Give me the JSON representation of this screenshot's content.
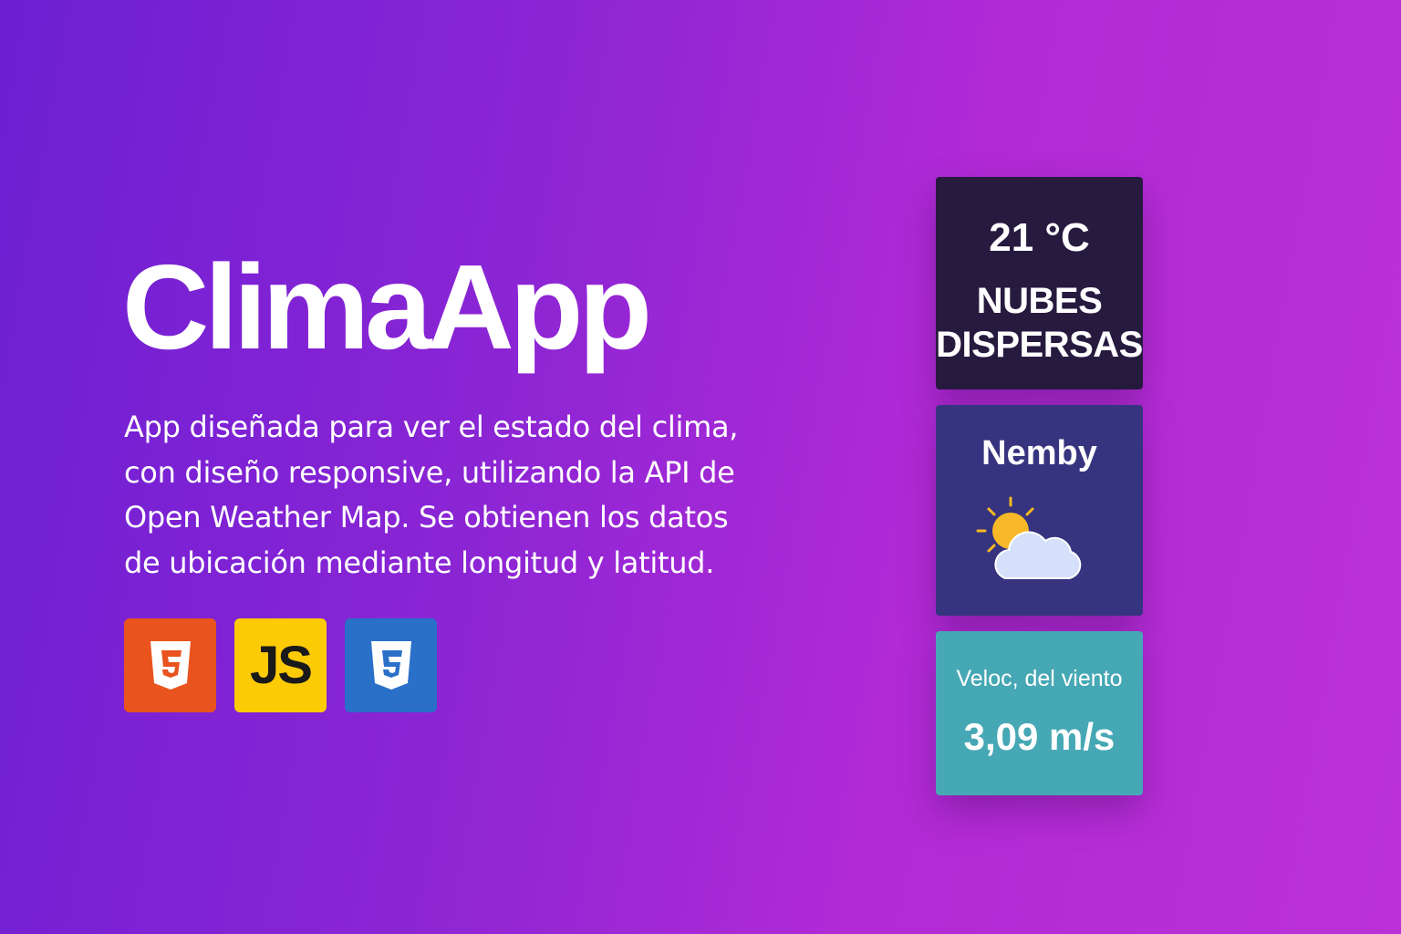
{
  "hero": {
    "title": "ClimaApp",
    "description_lines": [
      "App diseñada para ver el estado del clima,",
      "con diseño responsive, utilizando la API de",
      "Open Weather Map. Se obtienen los datos",
      "de ubicación mediante longitud y latitud."
    ],
    "tech": [
      {
        "name": "html5-icon",
        "label": "5",
        "color": "#e9531d"
      },
      {
        "name": "javascript-icon",
        "label": "JS",
        "color": "#fdcb06"
      },
      {
        "name": "css3-icon",
        "label": "5",
        "color": "#2a70c9"
      }
    ]
  },
  "weather": {
    "temperature": "21 °C",
    "condition_line1": "NUBES",
    "condition_line2": "DISPERSAS",
    "city": "Nemby",
    "icon": "partly-cloudy-icon",
    "wind_label": "Veloc, del viento",
    "wind_value": "3,09 m/s"
  }
}
